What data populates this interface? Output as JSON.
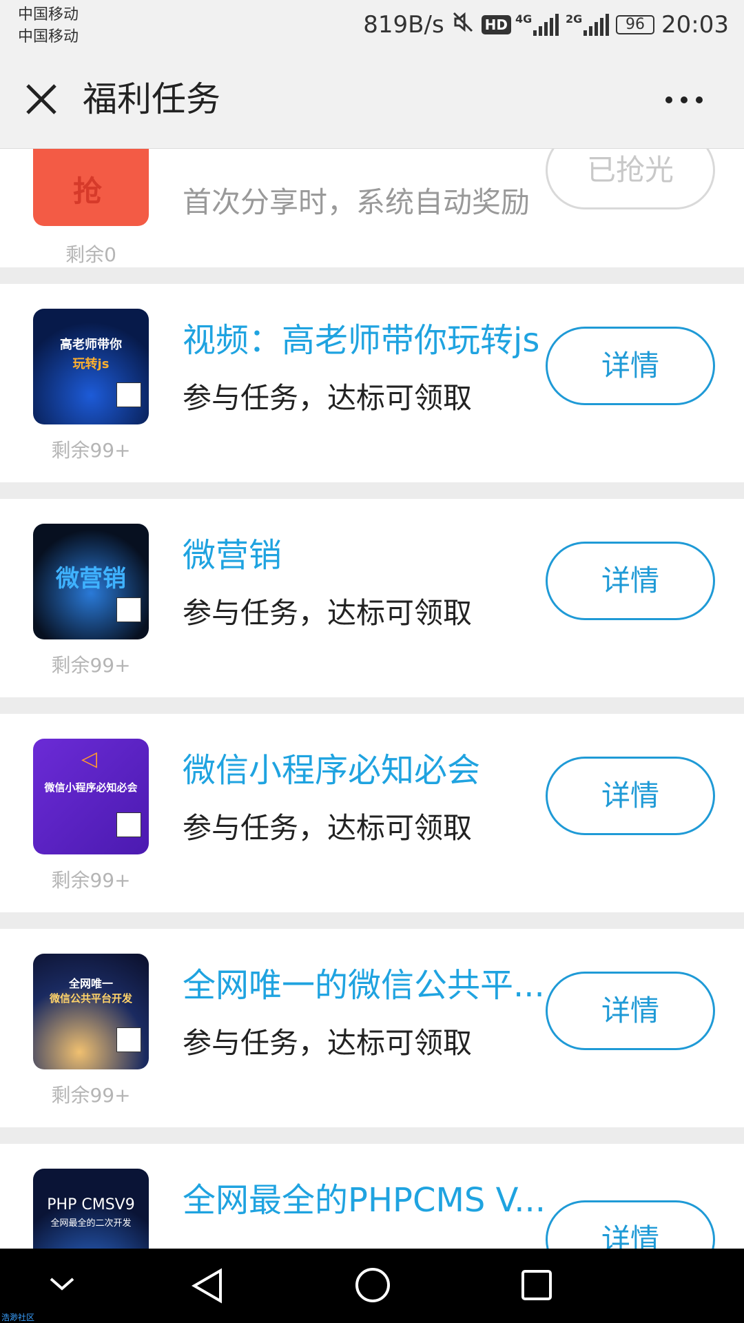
{
  "status_bar": {
    "carrier_1": "中国移动",
    "carrier_2": "中国移动",
    "speed": "819B/s",
    "hd": "HD",
    "net_1": "4G",
    "net_2": "2G",
    "battery": "96",
    "time": "20:03"
  },
  "nav": {
    "title": "福利任务"
  },
  "tasks": [
    {
      "title": "",
      "desc": "首次分享时，系统自动奖励",
      "button": "已抢光",
      "remain": "剩余0",
      "thumb_text": "",
      "thumb_text_2": ""
    },
    {
      "title": "视频：高老师带你玩转js",
      "desc": "参与任务，达标可领取",
      "button": "详情",
      "remain": "剩余99+",
      "thumb_text": "高老师带你",
      "thumb_text_2": "玩转js"
    },
    {
      "title": "微营销",
      "desc": "参与任务，达标可领取",
      "button": "详情",
      "remain": "剩余99+",
      "thumb_text": "微营销",
      "thumb_text_2": ""
    },
    {
      "title": "微信小程序必知必会",
      "desc": "参与任务，达标可领取",
      "button": "详情",
      "remain": "剩余99+",
      "thumb_text": "微信小程序必知必会",
      "thumb_text_2": ""
    },
    {
      "title": "全网唯一的微信公共平...",
      "desc": "参与任务，达标可领取",
      "button": "详情",
      "remain": "剩余99+",
      "thumb_text": "全网唯一",
      "thumb_text_2": "微信公共平台开发"
    },
    {
      "title": "全网最全的PHPCMS V...",
      "desc": "",
      "button": "详情",
      "remain": "",
      "thumb_text": "PHP CMSV9",
      "thumb_text_2": "全网最全的二次开发"
    }
  ],
  "watermark": "浩渺社区",
  "colors": {
    "accent": "#1fa3e0",
    "remain_grey": "#b5b5b5",
    "nav_bg": "#f1f1f1"
  }
}
